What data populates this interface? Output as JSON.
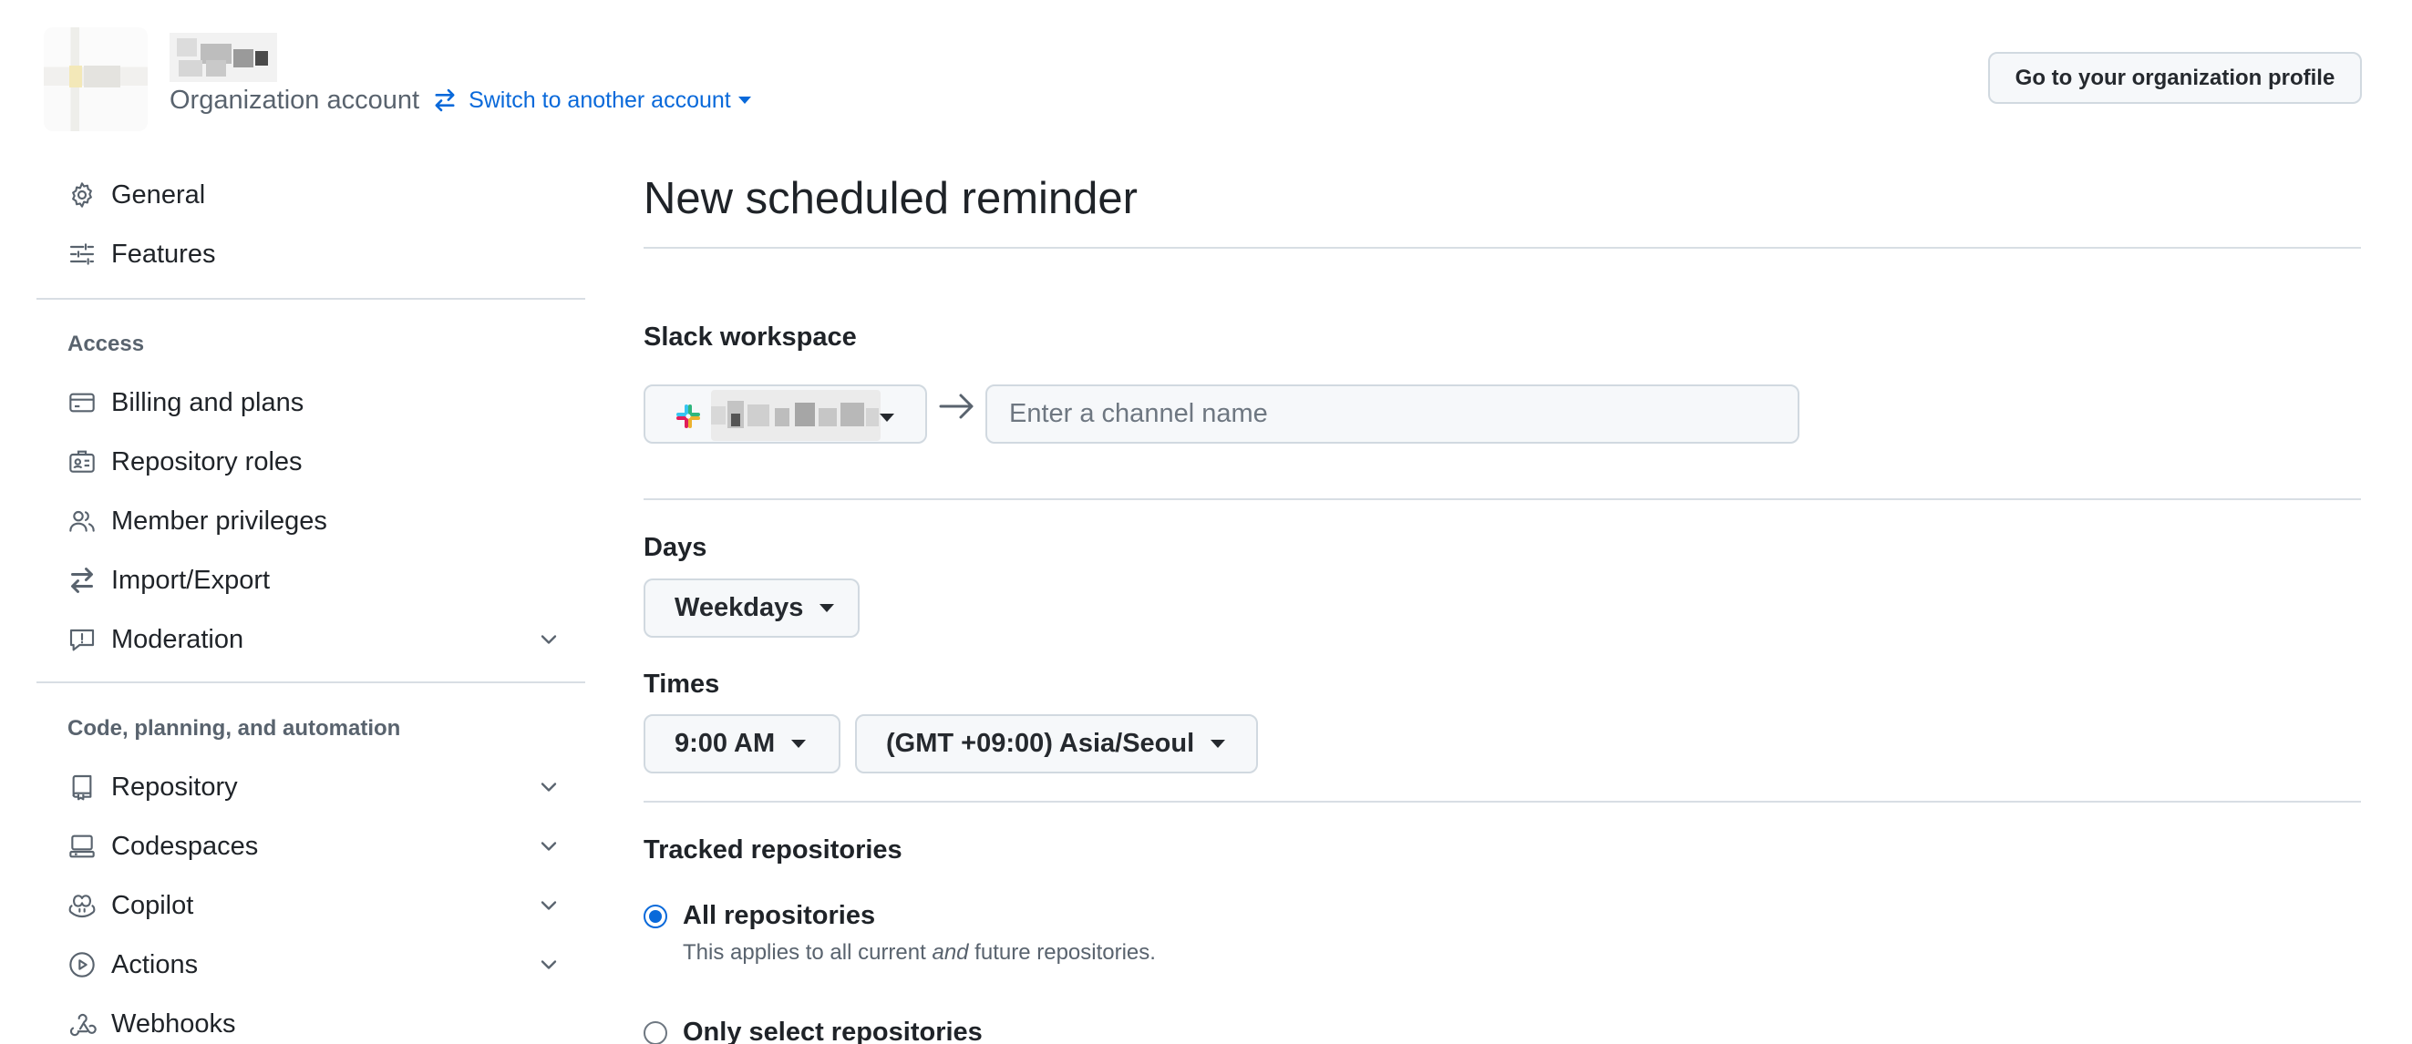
{
  "header": {
    "account_type": "Organization account",
    "switch_label": "Switch to another account",
    "profile_button": "Go to your organization profile"
  },
  "sidebar": {
    "top_items": [
      {
        "label": "General",
        "icon": "gear-icon"
      },
      {
        "label": "Features",
        "icon": "sliders-icon"
      }
    ],
    "access_heading": "Access",
    "access_items": [
      {
        "label": "Billing and plans",
        "icon": "credit-card-icon"
      },
      {
        "label": "Repository roles",
        "icon": "id-badge-icon"
      },
      {
        "label": "Member privileges",
        "icon": "people-icon"
      },
      {
        "label": "Import/Export",
        "icon": "arrow-switch-icon"
      },
      {
        "label": "Moderation",
        "icon": "report-icon",
        "expandable": true
      }
    ],
    "code_heading": "Code, planning, and automation",
    "code_items": [
      {
        "label": "Repository",
        "icon": "repo-icon",
        "expandable": true
      },
      {
        "label": "Codespaces",
        "icon": "codespaces-icon",
        "expandable": true
      },
      {
        "label": "Copilot",
        "icon": "copilot-icon",
        "expandable": true
      },
      {
        "label": "Actions",
        "icon": "play-icon",
        "expandable": true
      },
      {
        "label": "Webhooks",
        "icon": "webhook-icon"
      }
    ]
  },
  "main": {
    "title": "New scheduled reminder",
    "slack_label": "Slack workspace",
    "channel_placeholder": "Enter a channel name",
    "days_label": "Days",
    "days_value": "Weekdays",
    "times_label": "Times",
    "time_value": "9:00 AM",
    "timezone_value": "(GMT +09:00) Asia/Seoul",
    "tracked_label": "Tracked repositories",
    "radio_all_label": "All repositories",
    "radio_all_note_pre": "This applies to all current ",
    "radio_all_note_em": "and",
    "radio_all_note_post": " future repositories.",
    "radio_select_label": "Only select repositories",
    "selected_option": "All repositories"
  },
  "colors": {
    "link": "#0969da",
    "border": "#d1d9e0",
    "button_bg": "#f6f8fa",
    "muted_text": "#59636e"
  }
}
